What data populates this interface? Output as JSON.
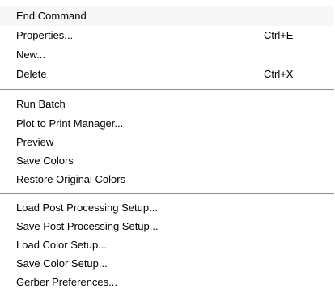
{
  "menu": {
    "group1": [
      {
        "label": "End Command",
        "shortcut": ""
      },
      {
        "label": "Properties...",
        "shortcut": "Ctrl+E"
      },
      {
        "label": "New...",
        "shortcut": ""
      },
      {
        "label": "Delete",
        "shortcut": "Ctrl+X"
      }
    ],
    "group2": [
      {
        "label": "Run Batch"
      },
      {
        "label": "Plot to Print Manager..."
      },
      {
        "label": "Preview"
      },
      {
        "label": "Save Colors"
      },
      {
        "label": "Restore Original Colors"
      }
    ],
    "group3": [
      {
        "label": "Load Post Processing Setup..."
      },
      {
        "label": "Save Post Processing Setup..."
      },
      {
        "label": "Load Color Setup..."
      },
      {
        "label": "Save Color Setup..."
      },
      {
        "label": "Gerber Preferences..."
      }
    ]
  }
}
